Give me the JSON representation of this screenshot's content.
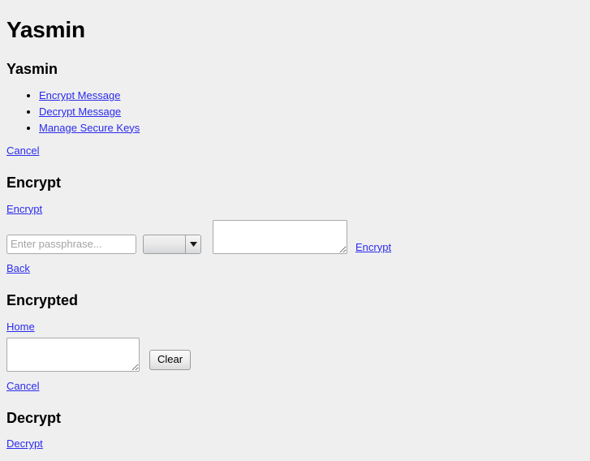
{
  "page": {
    "title": "Yasmin",
    "background_color": "#efefef",
    "link_color": "#2b2bee"
  },
  "home": {
    "heading": "Yasmin",
    "menu_items": [
      {
        "label": "Encrypt Message"
      },
      {
        "label": "Decrypt Message"
      },
      {
        "label": "Manage Secure Keys"
      }
    ],
    "cancel_label": "Cancel"
  },
  "encrypt": {
    "heading": "Encrypt",
    "top_link_label": "Encrypt",
    "passphrase": {
      "value": "",
      "placeholder": "Enter passphrase..."
    },
    "key_select": {
      "selected": "",
      "arrow_icon": "chevron-down-icon"
    },
    "message": {
      "value": ""
    },
    "submit_link_label": "Encrypt",
    "back_label": "Back"
  },
  "encrypted": {
    "heading": "Encrypted",
    "home_label": "Home",
    "result": {
      "value": ""
    },
    "clear_label": "Clear",
    "cancel_label": "Cancel"
  },
  "decrypt": {
    "heading": "Decrypt",
    "top_link_label": "Decrypt"
  }
}
